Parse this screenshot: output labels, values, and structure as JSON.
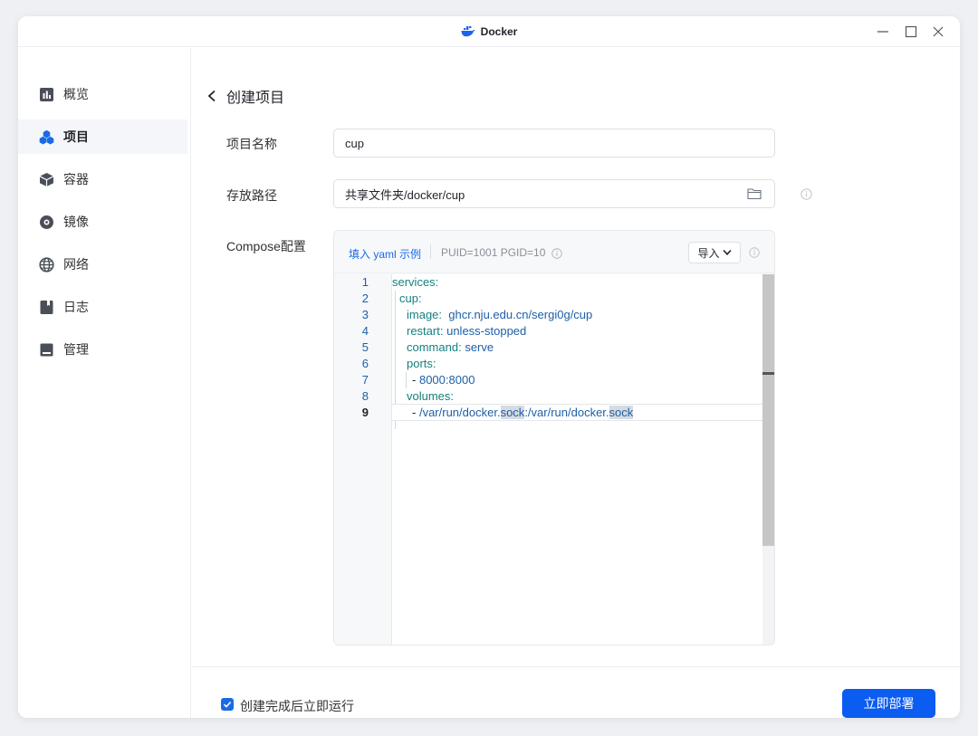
{
  "window": {
    "title": "Docker"
  },
  "sidebar": {
    "items": [
      {
        "label": "概览",
        "icon": "overview-icon",
        "active": false
      },
      {
        "label": "项目",
        "icon": "project-icon",
        "active": true
      },
      {
        "label": "容器",
        "icon": "container-icon",
        "active": false
      },
      {
        "label": "镜像",
        "icon": "image-icon",
        "active": false
      },
      {
        "label": "网络",
        "icon": "network-icon",
        "active": false
      },
      {
        "label": "日志",
        "icon": "log-icon",
        "active": false
      },
      {
        "label": "管理",
        "icon": "manage-icon",
        "active": false
      }
    ]
  },
  "page": {
    "title": "创建项目"
  },
  "form": {
    "name_label": "项目名称",
    "name_value": "cup",
    "path_label": "存放路径",
    "path_value": "共享文件夹/docker/cup",
    "compose_label": "Compose配置"
  },
  "compose": {
    "fill_example_link": "填入 yaml 示例",
    "env_hint": "PUID=1001 PGID=10",
    "import_label": "导入",
    "lines": [
      {
        "no": "1",
        "key": "services:",
        "val": ""
      },
      {
        "no": "2",
        "key": "cup:",
        "val": ""
      },
      {
        "no": "3",
        "key": "image:",
        "val": "ghcr.nju.edu.cn/sergi0g/cup"
      },
      {
        "no": "4",
        "key": "restart:",
        "val": "unless-stopped"
      },
      {
        "no": "5",
        "key": "command:",
        "val": "serve"
      },
      {
        "no": "6",
        "key": "ports:",
        "val": ""
      },
      {
        "no": "7",
        "key": "-",
        "val": "8000:8000"
      },
      {
        "no": "8",
        "key": "volumes:",
        "val": ""
      },
      {
        "no": "9",
        "key": "-",
        "val": "/var/run/docker.sock:/var/run/docker.sock"
      }
    ],
    "line9_parts": [
      "/var/run/docker.",
      "sock",
      ":/var/run/docker.",
      "sock"
    ]
  },
  "footer": {
    "run_after_create_label": "创建完成后立即运行",
    "run_after_create_checked": true,
    "deploy_label": "立即部署"
  },
  "colors": {
    "accent": "#0b5cf0",
    "link": "#1a6ae6",
    "yaml_key": "#157f7f",
    "yaml_value": "#1d5fa8"
  }
}
